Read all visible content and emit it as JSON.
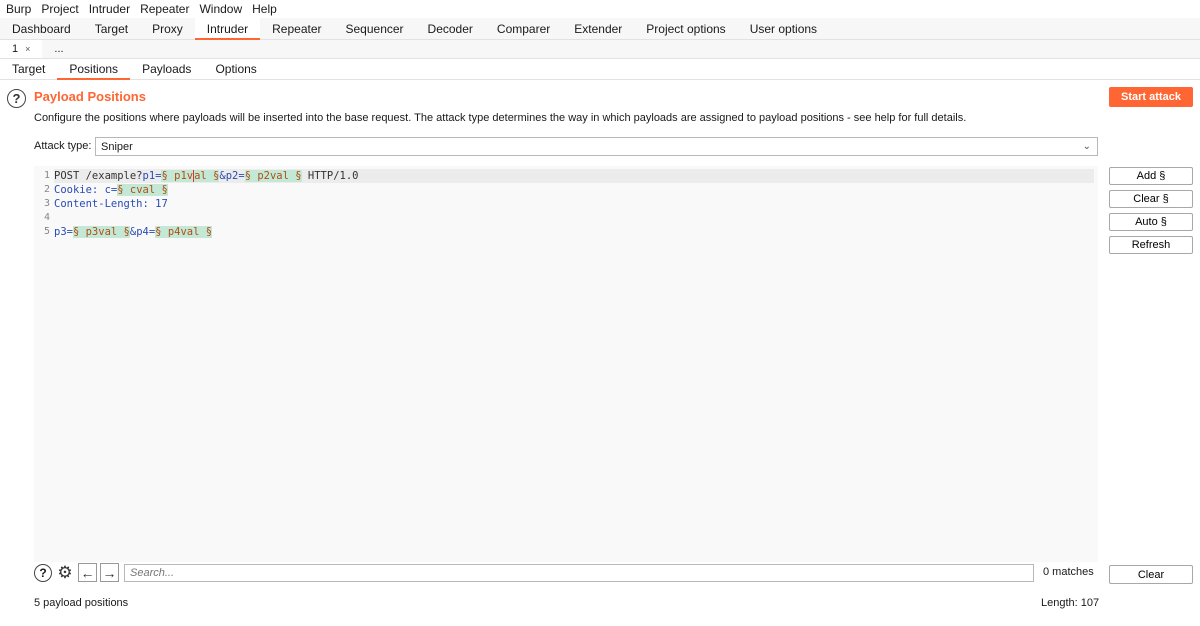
{
  "menubar": [
    "Burp",
    "Project",
    "Intruder",
    "Repeater",
    "Window",
    "Help"
  ],
  "main_tabs": [
    "Dashboard",
    "Target",
    "Proxy",
    "Intruder",
    "Repeater",
    "Sequencer",
    "Decoder",
    "Comparer",
    "Extender",
    "Project options",
    "User options"
  ],
  "main_tab_active": "Intruder",
  "attack_tabs": {
    "tab1": "1",
    "tab1_close": "×",
    "more": "..."
  },
  "sub_tabs": [
    "Target",
    "Positions",
    "Payloads",
    "Options"
  ],
  "sub_tab_active": "Positions",
  "section": {
    "title": "Payload Positions",
    "description": "Configure the positions where payloads will be inserted into the base request. The attack type determines the way in which payloads are assigned to payload positions - see help for full details.",
    "start_button": "Start attack"
  },
  "attack_type": {
    "label": "Attack type:",
    "value": "Sniper"
  },
  "editor": {
    "line_numbers": [
      "1",
      "2",
      "3",
      "4",
      "5"
    ],
    "request_lines": [
      "POST /example?p1=§p1val§&p2=§p2val§ HTTP/1.0",
      "Cookie: c=§cval§",
      "Content-Length: 17",
      "",
      "p3=§p3val§&p4=§p4val§"
    ],
    "l1": {
      "a": "POST /example?",
      "b": "p1=",
      "c": "§ p1v",
      "d": "al §",
      "e": "&p2=",
      "f": "§ p2val §",
      "g": " HTTP/1.0"
    },
    "l2": {
      "a": "Cookie: ",
      "b": "c=",
      "c": "§ cval §"
    },
    "l3": {
      "a": "Content-Length: 17"
    },
    "l5": {
      "a": "p3=",
      "b": "§ p3val §",
      "c": "&p4=",
      "d": "§ p4val §"
    }
  },
  "side_buttons": [
    "Add §",
    "Clear §",
    "Auto §",
    "Refresh"
  ],
  "search": {
    "placeholder": "Search...",
    "matches": "0 matches",
    "clear": "Clear"
  },
  "status": {
    "positions": "5 payload positions",
    "length": "Length: 107"
  },
  "colors": {
    "accent": "#ff6633",
    "payload_bg": "#c4e8d6",
    "payload_fg": "#b14e14",
    "param_fg": "#2a4bb5"
  },
  "icons": [
    "help-icon",
    "gear-icon",
    "arrow-left-icon",
    "arrow-right-icon",
    "chevron-down-icon",
    "close-icon"
  ]
}
